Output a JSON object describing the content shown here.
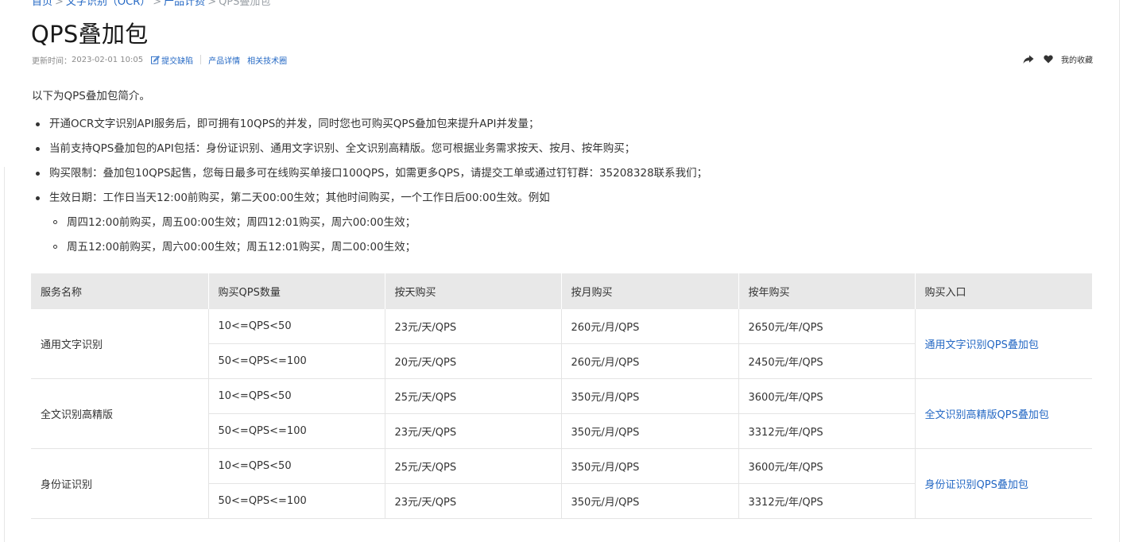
{
  "breadcrumb": {
    "items": [
      "首页",
      "文字识别（OCR）",
      "产品计费",
      "QPS叠加包"
    ],
    "separator": ">"
  },
  "title": "QPS叠加包",
  "meta": {
    "updated_label": "更新时间：",
    "updated_value": "2023-02-01 10:05",
    "report_label": "提交缺陷",
    "product_link": "产品详情",
    "community_link": "相关技术圈"
  },
  "actions": {
    "favorite_label": "我的收藏"
  },
  "intro": "以下为QPS叠加包简介。",
  "bullets": [
    "开通OCR文字识别API服务后，即可拥有10QPS的并发，同时您也可购买QPS叠加包来提升API并发量；",
    "当前支持QPS叠加包的API包括：身份证识别、通用文字识别、全文识别高精版。您可根据业务需求按天、按月、按年购买；",
    "购买限制：叠加包10QPS起售，您每日最多可在线购买单接口100QPS，如需更多QPS，请提交工单或通过钉钉群：35208328联系我们；",
    "生效日期：工作日当天12:00前购买，第二天00:00生效；其他时间购买，一个工作日后00:00生效。例如"
  ],
  "sub_bullets": [
    "周四12:00前购买，周五00:00生效；周四12:01购买，周六00:00生效；",
    "周五12:00前购买，周六00:00生效；周五12:01购买，周二00:00生效；"
  ],
  "table": {
    "headers": [
      "服务名称",
      "购买QPS数量",
      "按天购买",
      "按月购买",
      "按年购买",
      "购买入口"
    ],
    "groups": [
      {
        "service": "通用文字识别",
        "link": "通用文字识别QPS叠加包",
        "rows": [
          {
            "qty": "10<=QPS<50",
            "day": "23元/天/QPS",
            "month": "260元/月/QPS",
            "year": "2650元/年/QPS"
          },
          {
            "qty": "50<=QPS<=100",
            "day": "20元/天/QPS",
            "month": "260元/月/QPS",
            "year": "2450元/年/QPS"
          }
        ]
      },
      {
        "service": "全文识别高精版",
        "link": "全文识别高精版QPS叠加包",
        "rows": [
          {
            "qty": "10<=QPS<50",
            "day": "25元/天/QPS",
            "month": "350元/月/QPS",
            "year": "3600元/年/QPS"
          },
          {
            "qty": "50<=QPS<=100",
            "day": "23元/天/QPS",
            "month": "350元/月/QPS",
            "year": "3312元/年/QPS"
          }
        ]
      },
      {
        "service": "身份证识别",
        "link": "身份证识别QPS叠加包",
        "rows": [
          {
            "qty": "10<=QPS<50",
            "day": "25元/天/QPS",
            "month": "350元/月/QPS",
            "year": "3600元/年/QPS"
          },
          {
            "qty": "50<=QPS<=100",
            "day": "23元/天/QPS",
            "month": "350元/月/QPS",
            "year": "3312元/年/QPS"
          }
        ]
      }
    ]
  },
  "icons": [
    "pencil-icon",
    "share-icon",
    "heart-icon"
  ],
  "colors": {
    "link": "#2468c4",
    "header_bg": "#e8e8e8",
    "text": "#333333"
  }
}
